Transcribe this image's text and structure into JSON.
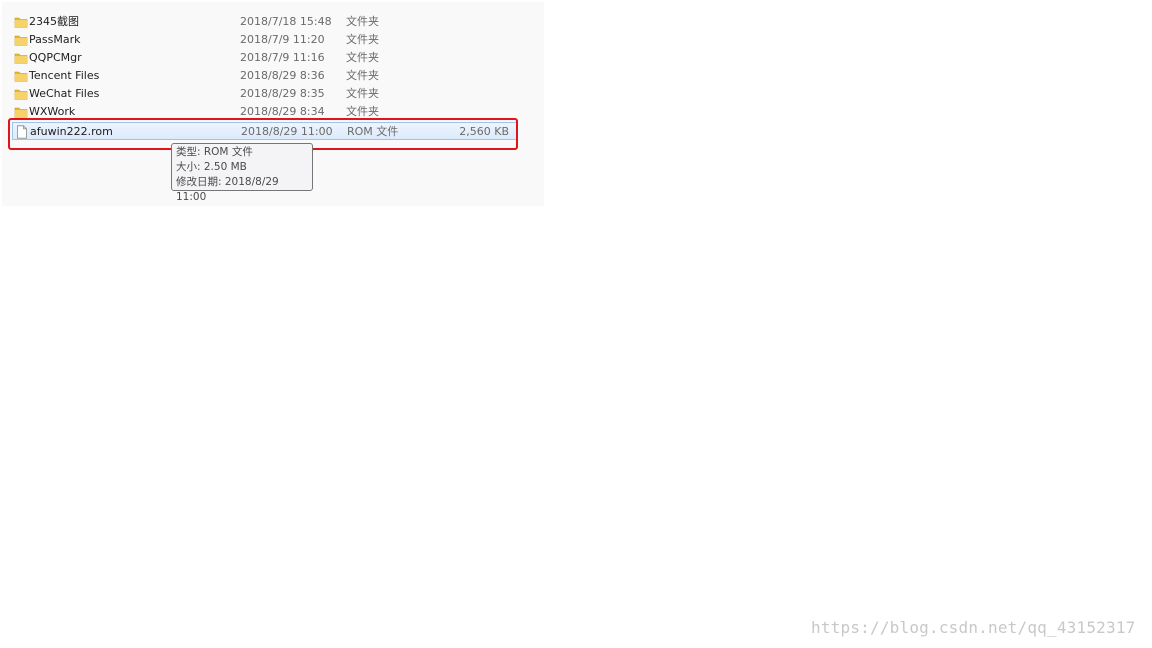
{
  "files": [
    {
      "name": "2345截图",
      "date": "2018/7/18 15:48",
      "type": "文件夹",
      "size": "",
      "icon": "folder-icon"
    },
    {
      "name": "PassMark",
      "date": "2018/7/9 11:20",
      "type": "文件夹",
      "size": "",
      "icon": "folder-icon"
    },
    {
      "name": "QQPCMgr",
      "date": "2018/7/9 11:16",
      "type": "文件夹",
      "size": "",
      "icon": "folder-icon"
    },
    {
      "name": "Tencent Files",
      "date": "2018/8/29 8:36",
      "type": "文件夹",
      "size": "",
      "icon": "folder-icon"
    },
    {
      "name": "WeChat Files",
      "date": "2018/8/29 8:35",
      "type": "文件夹",
      "size": "",
      "icon": "folder-icon"
    },
    {
      "name": "WXWork",
      "date": "2018/8/29 8:34",
      "type": "文件夹",
      "size": "",
      "icon": "folder-icon"
    },
    {
      "name": "afuwin222.rom",
      "date": "2018/8/29 11:00",
      "type": "ROM 文件",
      "size": "2,560 KB",
      "icon": "file-icon",
      "selected": true
    }
  ],
  "tooltip": {
    "type_line": "类型: ROM 文件",
    "size_line": "大小: 2.50 MB",
    "modified_line": "修改日期: 2018/8/29 11:00"
  },
  "watermark": "https://blog.csdn.net/qq_43152317",
  "colors": {
    "highlight_box": "#e0141c",
    "selection": "#dbeafb",
    "folder": "#e8b830"
  }
}
